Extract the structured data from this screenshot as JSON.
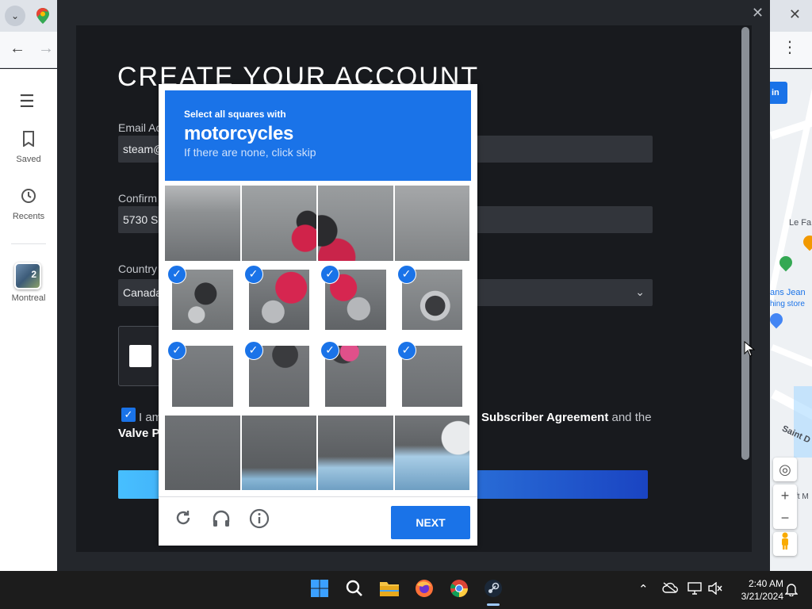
{
  "browser": {
    "tab_dropdown_icon": "chevron-down-icon",
    "back_icon": "arrow-left-icon",
    "forward_icon": "arrow-right-icon",
    "window_close_icon": "close-icon",
    "menu_icon": "kebab-icon"
  },
  "maps_sidebar": {
    "items": [
      {
        "label": "Saved",
        "icon": "bookmark-icon"
      },
      {
        "label": "Recents",
        "icon": "history-icon"
      }
    ],
    "place": {
      "label": "Montreal",
      "count": "2"
    }
  },
  "map": {
    "signin_label": "in",
    "labels": [
      "Le Fa",
      "ans Jean",
      "hing store",
      "Saint D",
      "ft M"
    ]
  },
  "steam": {
    "title": "CREATE YOUR ACCOUNT",
    "email_label": "Email Ac",
    "email_value": "steam@",
    "confirm_label": "Confirm",
    "confirm_value": "5730 S",
    "country_label": "Country",
    "country_value": "Canada",
    "agree_prefix": "I am",
    "agree_link": "Subscriber Agreement",
    "agree_and": "and the",
    "agree_line2": "Valve Pr"
  },
  "recaptcha": {
    "instruction": "Select all squares with",
    "target": "motorcycles",
    "hint": "If there are none, click skip",
    "next_label": "NEXT",
    "selected_tiles": [
      4,
      5,
      6,
      7,
      8,
      9,
      10,
      11
    ]
  },
  "taskbar": {
    "time": "2:40 AM",
    "date": "3/21/2024"
  },
  "colors": {
    "recaptcha_blue": "#1a73e8",
    "steam_bg": "#181a1e",
    "steam_input": "#32353b"
  }
}
